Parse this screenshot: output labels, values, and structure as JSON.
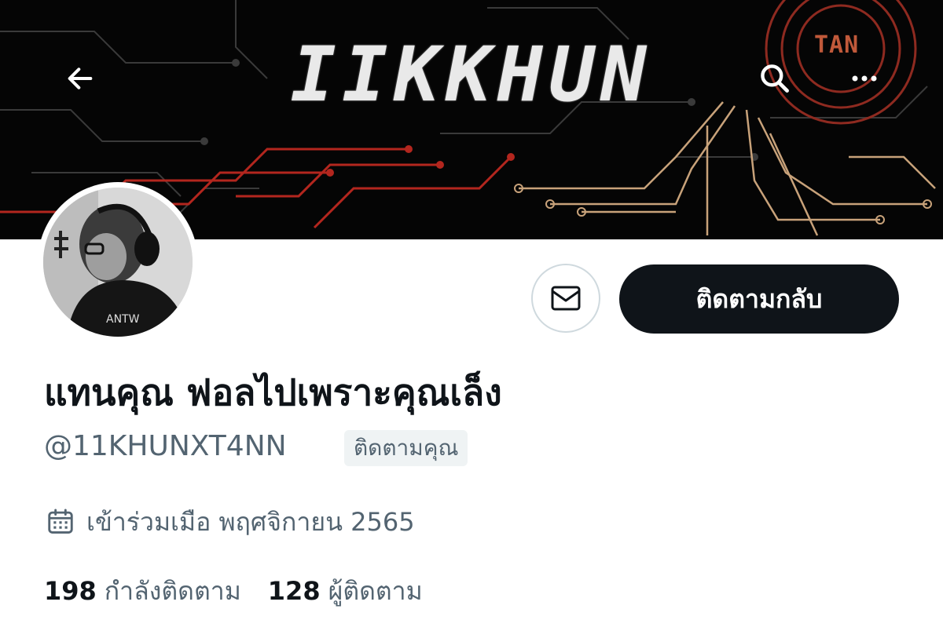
{
  "banner": {
    "title": "IIKKHUN",
    "badge": "TAN"
  },
  "nav": {
    "back_icon": "arrow-left-icon",
    "search_icon": "search-icon",
    "more_icon": "more-horizontal-icon"
  },
  "actions": {
    "message_icon": "envelope-icon",
    "follow_back_label": "ติดตามกลับ"
  },
  "profile": {
    "display_name": "แทนคุณ ฟอลไปเพราะคุณเล็ง",
    "handle": "@11KHUNXT4NN",
    "follows_you_badge": "ติดตามคุณ",
    "joined_icon": "calendar-icon",
    "joined_text": "เข้าร่วมเมือ พฤศจิกายน 2565"
  },
  "stats": {
    "following_count": "198",
    "following_label": "กำลังติดตาม",
    "followers_count": "128",
    "followers_label": "ผู้ติดตาม"
  },
  "colors": {
    "primary_text": "#0f1419",
    "secondary_text": "#536471",
    "follow_button_bg": "#0f1419",
    "badge_bg": "#eff3f4",
    "banner_bg": "#050505",
    "circuit_red": "#b3261e",
    "circuit_gold": "#c8a27a"
  }
}
